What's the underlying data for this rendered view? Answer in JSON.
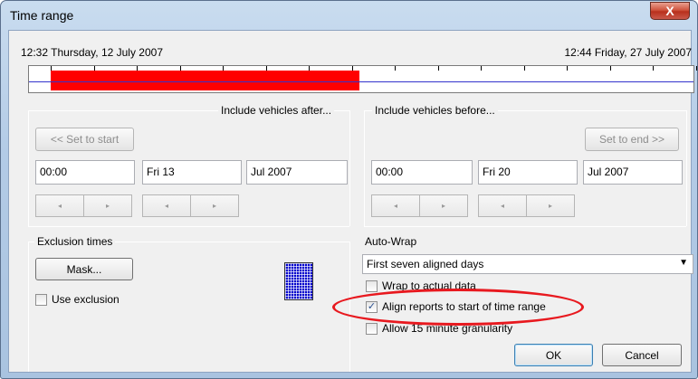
{
  "window": {
    "title": "Time range",
    "close_glyph": "X"
  },
  "timeline": {
    "start_label": "12:32 Thursday, 12 July 2007",
    "end_label": "12:44 Friday, 27 July 2007",
    "range_start_fraction": 0.033,
    "range_end_fraction": 0.497,
    "range_color": "#ff0000",
    "baseline_color": "#3333cc"
  },
  "after_group": {
    "title": "Include vehicles after...",
    "set_button": "<< Set to start",
    "time": "00:00",
    "day": "Fri 13",
    "month": "Jul 2007"
  },
  "before_group": {
    "title": "Include vehicles before...",
    "set_button": "Set to end >>",
    "time": "00:00",
    "day": "Fri 20",
    "month": "Jul 2007"
  },
  "spin_glyphs": {
    "left": "◂",
    "right": "▸"
  },
  "exclusion": {
    "title": "Exclusion times",
    "mask_button": "Mask...",
    "use_exclusion_label": "Use exclusion",
    "use_exclusion_checked": false,
    "icon": "grid-calendar-icon"
  },
  "autowrap": {
    "title": "Auto-Wrap",
    "selected_option": "First seven aligned days",
    "dropdown_arrow": "▼",
    "options": [
      {
        "label": "Wrap to actual data",
        "checked": false,
        "mark": ""
      },
      {
        "label": "Align reports to start of time range",
        "checked": true,
        "mark": "✓"
      },
      {
        "label": "Allow 15 minute granularity",
        "checked": false,
        "mark": ""
      }
    ]
  },
  "footer": {
    "ok": "OK",
    "cancel": "Cancel"
  },
  "colors": {
    "highlight": "#e8191f",
    "accent": "#3c7fb1"
  }
}
